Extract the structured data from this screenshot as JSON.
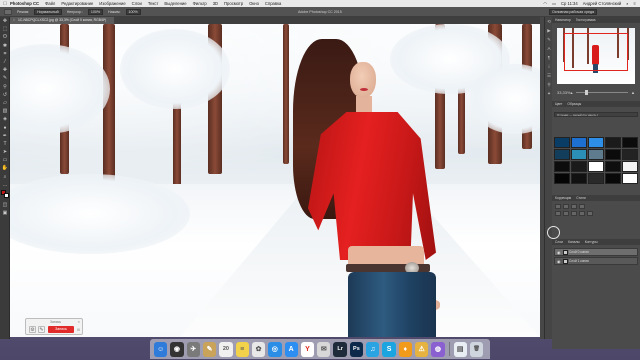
{
  "menubar": {
    "apple": "",
    "app_name": "Photoshop CC",
    "items": [
      "Файл",
      "Редактирование",
      "Изображение",
      "Слои",
      "Текст",
      "Выделение",
      "Фильтр",
      "3D",
      "Просмотр",
      "Окно",
      "Справка"
    ],
    "clock": "Ср 11:34",
    "user": "Андрей Столянский"
  },
  "options_bar": {
    "mode_label": "Режим:",
    "mode_value": "Нормальный",
    "opacity_label": "Непрозр.:",
    "opacity_value": "100%",
    "flow_label": "Нажим:",
    "flow_value": "100%",
    "window_title": "Adobe Photoshop CC 2015",
    "workspace": "Основная рабочая среда"
  },
  "document_tab": {
    "close": "×",
    "title": "1C-N5CPQCLXSC2.jpg @ 33,3% (Слой 0 копия, RGB/8*)"
  },
  "panels": {
    "navigator_tabs": [
      "Навигатор",
      "Гистограмма"
    ],
    "zoom_value": "33,33%",
    "swatches_tabs": [
      "Цвет",
      "Образцы"
    ],
    "preset_name": "Оттенки — серый (по умолч.)",
    "swatch_colors": [
      "#0a3d66",
      "#1d6fd0",
      "#2e8fe8",
      "#1b1b1b",
      "#0c0c0c",
      "#123e5c",
      "#2b8fb6",
      "#5f7c8e",
      "#0b0b0b",
      "#232323",
      "#0d0d0d",
      "#1a1a1a",
      "#ffffff",
      "#0e0e0e",
      "#f5f5f5",
      "#050505",
      "#111111",
      "#2a2a2a",
      "#090909",
      "#ffffff"
    ],
    "adjust_tabs": [
      "Коррекция",
      "Стили"
    ],
    "layers_tabs": [
      "Слои",
      "Каналы",
      "Контуры"
    ],
    "layers": [
      {
        "name": "Слой 0 копия",
        "selected": true
      },
      {
        "name": "Слой 1 копия",
        "selected": false
      }
    ]
  },
  "recorder": {
    "title": "Запись",
    "close": "×",
    "record_label": "Запись",
    "pause_label": "II"
  },
  "dock": {
    "icons": [
      {
        "name": "finder-icon",
        "glyph": "☺",
        "color": "#2f7bd9"
      },
      {
        "name": "dashboard-icon",
        "glyph": "◉",
        "color": "#333333"
      },
      {
        "name": "launchpad-icon",
        "glyph": "✈",
        "color": "#7a7a7a"
      },
      {
        "name": "notes-icon",
        "glyph": "✎",
        "color": "#c9a35a"
      },
      {
        "name": "calendar-icon",
        "glyph": "20",
        "color": "#f0f0f0"
      },
      {
        "name": "stickies-icon",
        "glyph": "≡",
        "color": "#f2d24b"
      },
      {
        "name": "photos-icon",
        "glyph": "✿",
        "color": "#e8e8e8"
      },
      {
        "name": "safari-icon",
        "glyph": "◎",
        "color": "#2a8ee6"
      },
      {
        "name": "appstore-icon",
        "glyph": "A",
        "color": "#2c8ef0"
      },
      {
        "name": "yandex-browser-icon",
        "glyph": "Y",
        "color": "#ffffff"
      },
      {
        "name": "mail-icon",
        "glyph": "✉",
        "color": "#d8d8d8"
      },
      {
        "name": "lightroom-icon",
        "glyph": "Lr",
        "color": "#1d2b3a"
      },
      {
        "name": "photoshop-icon",
        "glyph": "Ps",
        "color": "#0e2a4a"
      },
      {
        "name": "itunes-icon",
        "glyph": "♫",
        "color": "#2aa3e3"
      },
      {
        "name": "skype-icon",
        "glyph": "S",
        "color": "#1ba5e0"
      },
      {
        "name": "vpn-icon",
        "glyph": "♦",
        "color": "#f29a1a"
      },
      {
        "name": "transmit-icon",
        "glyph": "⚠",
        "color": "#e6b340"
      },
      {
        "name": "gpu-icon",
        "glyph": "◍",
        "color": "#8a5fd0"
      },
      {
        "name": "documents-folder-icon",
        "glyph": "▤",
        "color": "#e9eef5"
      },
      {
        "name": "trash-icon",
        "glyph": "🗑",
        "color": "#cfd6de"
      }
    ]
  }
}
